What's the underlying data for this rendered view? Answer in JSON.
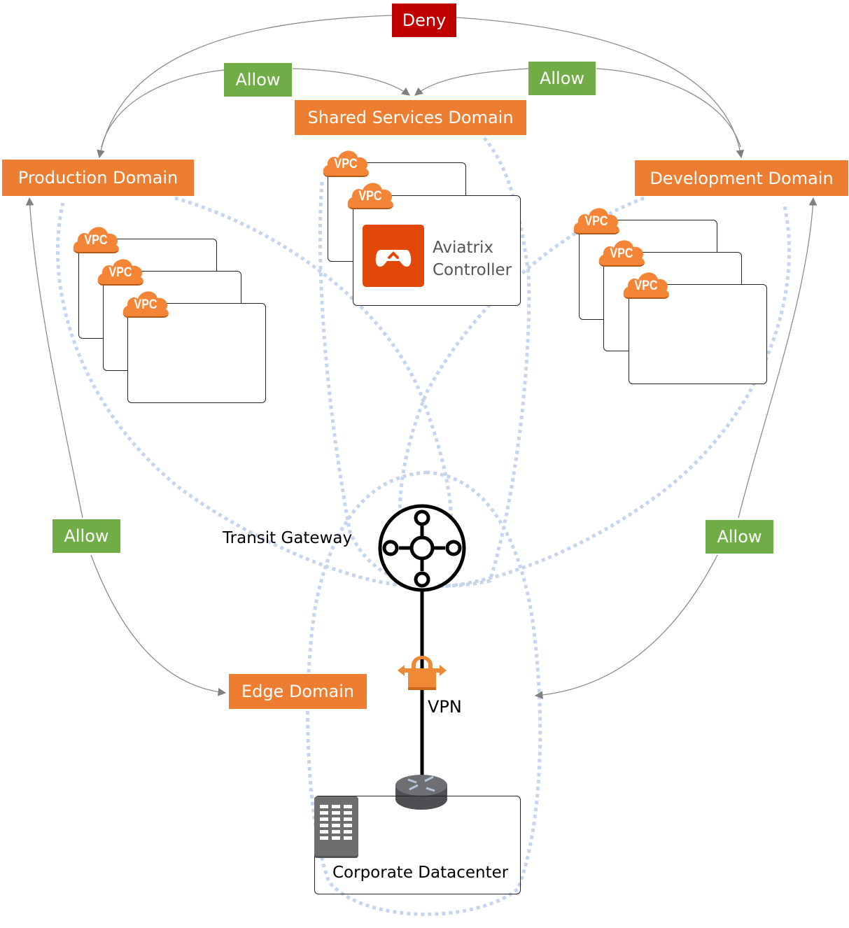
{
  "policy": {
    "deny_label": "Deny",
    "allow_labels": [
      "Allow",
      "Allow",
      "Allow",
      "Allow"
    ]
  },
  "domains": {
    "production": "Production Domain",
    "shared": "Shared Services Domain",
    "development": "Development Domain",
    "edge": "Edge Domain"
  },
  "vpc_label": "VPC",
  "controller": {
    "line1": "Aviatrix",
    "line2": "Controller"
  },
  "transit_gateway_label": "Transit Gateway",
  "vpn_label": "VPN",
  "datacenter_label": "Corporate Datacenter",
  "colors": {
    "domain": "#ed7d31",
    "allow": "#70ad47",
    "deny": "#c00000",
    "dotted_boundary": "#c5d5ee",
    "arrow": "#8c8c8c",
    "vpc_cloud": "#f58536",
    "aviatrix_logo": "#e24808"
  }
}
